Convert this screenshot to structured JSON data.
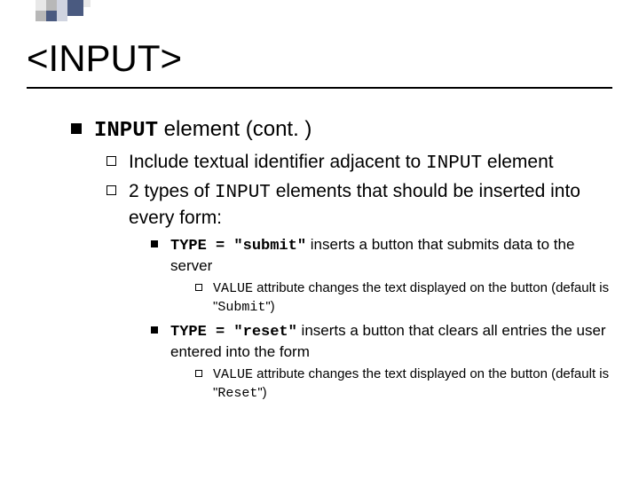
{
  "title": "<INPUT>",
  "l1": {
    "code": "INPUT",
    "rest": " element (cont. )"
  },
  "l2a": {
    "pre": "Include textual identifier adjacent to ",
    "code": "INPUT",
    "post": " element"
  },
  "l2b": {
    "pre": "2 types of ",
    "code": "INPUT",
    "post": " elements that should be inserted into every form:"
  },
  "l3a": {
    "code": "TYPE = \"submit\"",
    "post": " inserts a button that submits data to the server"
  },
  "l4a": {
    "code1": "VALUE",
    "mid": " attribute changes the text displayed on the button (default is \"",
    "code2": "Submit",
    "post": "\")"
  },
  "l3b": {
    "code": "TYPE = \"reset\"",
    "post": " inserts a button that clears all entries the user entered into the form"
  },
  "l4b": {
    "code1": "VALUE",
    "mid": " attribute changes the text displayed on the button (default is \"",
    "code2": "Reset",
    "post": "\")"
  }
}
